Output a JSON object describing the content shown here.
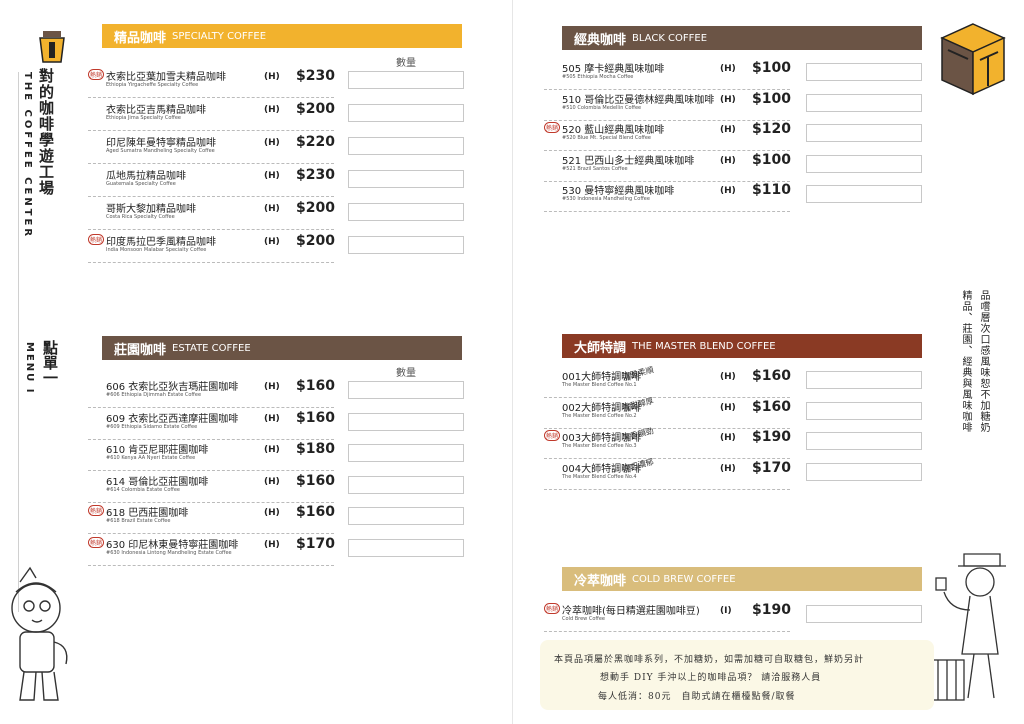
{
  "brand": {
    "name_zh": "對的咖啡學遊工場",
    "name_en": "THE COFFEE CENTER",
    "menu_zh": "點單一",
    "menu_en": "MENU I"
  },
  "colors": {
    "yellow": "#f2b22d",
    "brown": "#6b5445",
    "red": "#8a3a24",
    "tan": "#d9bd7c"
  },
  "qty_label": "數量",
  "hot_label": "熱銷",
  "sections": {
    "specialty": {
      "zh": "精品咖啡",
      "en": "SPECIALTY COFFEE",
      "items": [
        {
          "zh": "衣索比亞葉加雪夫精品咖啡",
          "en": "Ethiopia Yirgacheffe Specialty Coffee",
          "size": "(H)",
          "price": "$230",
          "hot": true
        },
        {
          "zh": "衣索比亞吉馬精品咖啡",
          "en": "Ethiopia Jima Specialty Coffee",
          "size": "(H)",
          "price": "$200",
          "hot": false
        },
        {
          "zh": "印尼陳年曼特寧精品咖啡",
          "en": "Aged Sumatra Mandheling Specialty Coffee",
          "size": "(H)",
          "price": "$220",
          "hot": false
        },
        {
          "zh": "瓜地馬拉精品咖啡",
          "en": "Guatemala Specialty Coffee",
          "size": "(H)",
          "price": "$230",
          "hot": false
        },
        {
          "zh": "哥斯大黎加精品咖啡",
          "en": "Costa Rica Specialty Coffee",
          "size": "(H)",
          "price": "$200",
          "hot": false
        },
        {
          "zh": "印度馬拉巴季風精品咖啡",
          "en": "India Monsoon Malabar Specialty Coffee",
          "size": "(H)",
          "price": "$200",
          "hot": true
        }
      ]
    },
    "estate": {
      "zh": "莊園咖啡",
      "en": "ESTATE COFFEE",
      "items": [
        {
          "zh": "606 衣索比亞狄吉瑪莊園咖啡",
          "en": "#606 Ethiopia Djimmah Estate Coffee",
          "size": "(H)",
          "price": "$160",
          "hot": false
        },
        {
          "zh": "609 衣索比亞西達摩莊園咖啡",
          "en": "#609 Ethiopia Sidamo Estate Coffee",
          "size": "(H)",
          "price": "$160",
          "hot": false
        },
        {
          "zh": "610 肯亞尼耶莊園咖啡",
          "en": "#610 Kenya AA Nyeri Estate Coffee",
          "size": "(H)",
          "price": "$180",
          "hot": false
        },
        {
          "zh": "614 哥倫比亞莊園咖啡",
          "en": "#614 Colombia Estate Coffee",
          "size": "(H)",
          "price": "$160",
          "hot": false
        },
        {
          "zh": "618 巴西莊園咖啡",
          "en": "#618 Brazil Estate Coffee",
          "size": "(H)",
          "price": "$160",
          "hot": true
        },
        {
          "zh": "630 印尼林東曼特寧莊園咖啡",
          "en": "#630 Indonesia Lintong Mandheling Estate Coffee",
          "size": "(H)",
          "price": "$170",
          "hot": true
        }
      ]
    },
    "black": {
      "zh": "經典咖啡",
      "en": "BLACK COFFEE",
      "items": [
        {
          "zh": "505 摩卡經典風味咖啡",
          "en": "#505 Ethiopia Mocha Coffee",
          "size": "(H)",
          "price": "$100",
          "hot": false
        },
        {
          "zh": "510 哥倫比亞曼德林經典風味咖啡",
          "en": "#510 Colombia Medellin Coffee",
          "size": "(H)",
          "price": "$100",
          "hot": false
        },
        {
          "zh": "520 藍山經典風味咖啡",
          "en": "#520 Blue Mt. Special Blend Coffee",
          "size": "(H)",
          "price": "$120",
          "hot": true
        },
        {
          "zh": "521 巴西山多士經典風味咖啡",
          "en": "#521 Brazil Santos Coffee",
          "size": "(H)",
          "price": "$100",
          "hot": false
        },
        {
          "zh": "530 曼特寧經典風味咖啡",
          "en": "#530 Indonesia Mandheling Coffee",
          "size": "(H)",
          "price": "$110",
          "hot": false
        }
      ]
    },
    "master": {
      "zh": "大師特調",
      "en": "THE MASTER BLEND COFFEE",
      "items": [
        {
          "zh": "001大師特調咖啡",
          "en": "The Master Blend Coffee No.1",
          "note": "清雅柔順",
          "size": "(H)",
          "price": "$160",
          "hot": false
        },
        {
          "zh": "002大師特調咖啡",
          "en": "The Master Blend Coffee No.2",
          "note": "香甜醇厚",
          "size": "(H)",
          "price": "$160",
          "hot": false
        },
        {
          "zh": "003大師特調咖啡",
          "en": "The Master Blend Coffee No.3",
          "note": "果香韻勁",
          "size": "(H)",
          "price": "$190",
          "hot": true
        },
        {
          "zh": "004大師特調咖啡",
          "en": "The Master Blend Coffee No.4",
          "note": "煉巧濃郁",
          "size": "(H)",
          "price": "$170",
          "hot": false
        }
      ]
    },
    "cold": {
      "zh": "冷萃咖啡",
      "en": "COLD BREW COFFEE",
      "items": [
        {
          "zh": "冷萃咖啡(每日精選莊園咖啡豆)",
          "en": "Cold Brew Coffee",
          "size": "(I)",
          "price": "$190",
          "hot": true
        }
      ]
    }
  },
  "slogan": {
    "col1": "品嚐層次口感風味恕不加糖奶",
    "col2": "精品、莊園、經典與風味咖啡"
  },
  "note": {
    "line1": "本頁品項屬於黑咖啡系列，不加糖奶，如需加糖可自取糖包，鮮奶另計",
    "line2": "想動手 DIY 手沖以上的咖啡品項？ 請洽服務人員",
    "line3": "每人低消：80元　自助式請在櫃檯點餐/取餐"
  }
}
